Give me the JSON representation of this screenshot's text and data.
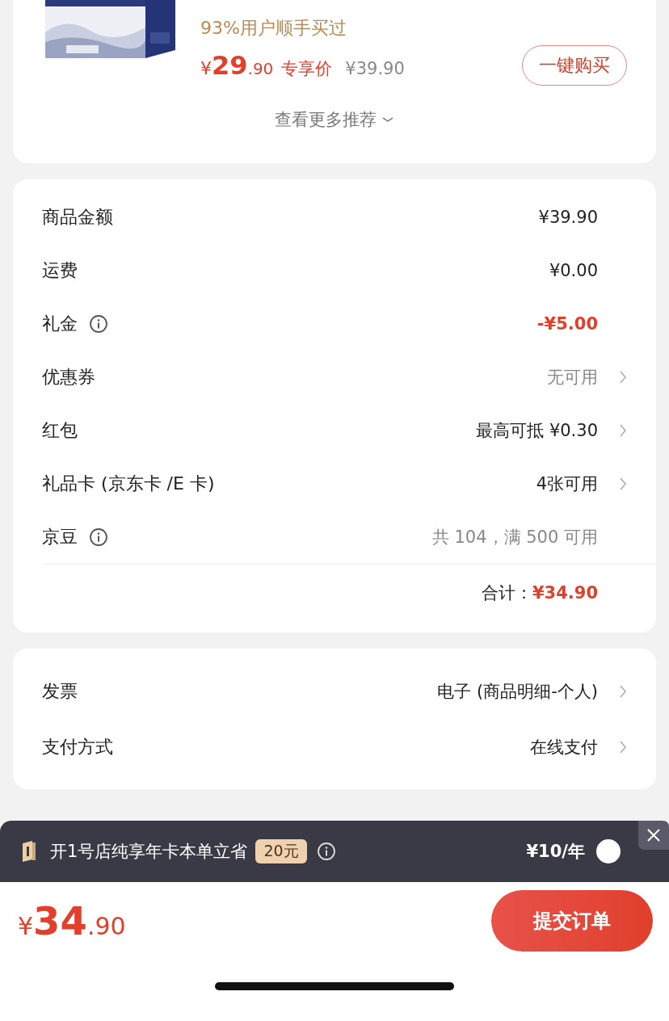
{
  "recommendation": {
    "tagline": "93%用户顺手买过",
    "price_symbol": "¥",
    "price_int": "29",
    "price_dec": ".90",
    "price_label": "专享价",
    "original_price": "¥39.90",
    "buy_button": "一键购买",
    "more_link": "查看更多推荐"
  },
  "summary": {
    "rows": [
      {
        "label": "商品金额",
        "value": "¥39.90",
        "kind": "plain",
        "info": false,
        "chevron": false
      },
      {
        "label": "运费",
        "value": "¥0.00",
        "kind": "plain",
        "info": false,
        "chevron": false
      },
      {
        "label": "礼金",
        "value": "-¥5.00",
        "kind": "discount",
        "info": true,
        "chevron": false
      },
      {
        "label": "优惠券",
        "value": "无可用",
        "kind": "muted",
        "info": false,
        "chevron": true
      },
      {
        "label": "红包",
        "value": "最高可抵 ¥0.30",
        "kind": "plain",
        "info": false,
        "chevron": true
      },
      {
        "label": "礼品卡 (京东卡 /E 卡)",
        "value": "4张可用",
        "kind": "plain",
        "info": false,
        "chevron": true
      },
      {
        "label": "京豆",
        "value": "共 104，满 500 可用",
        "kind": "muted",
        "info": true,
        "chevron": false
      }
    ],
    "total_label": "合计：",
    "total_value": "¥34.90"
  },
  "options": {
    "rows": [
      {
        "label": "发票",
        "value": "电子 (商品明细-个人)",
        "kind": "plain",
        "info": false,
        "chevron": true
      },
      {
        "label": "支付方式",
        "value": "在线支付",
        "kind": "plain",
        "info": false,
        "chevron": true
      }
    ]
  },
  "membership": {
    "text": "开1号店纯享年卡本单立省",
    "badge": "20元",
    "price": "¥10/年",
    "selected": false
  },
  "footer": {
    "price_symbol": "¥",
    "price_int": "34",
    "price_dec": ".90",
    "submit_button": "提交订单"
  }
}
